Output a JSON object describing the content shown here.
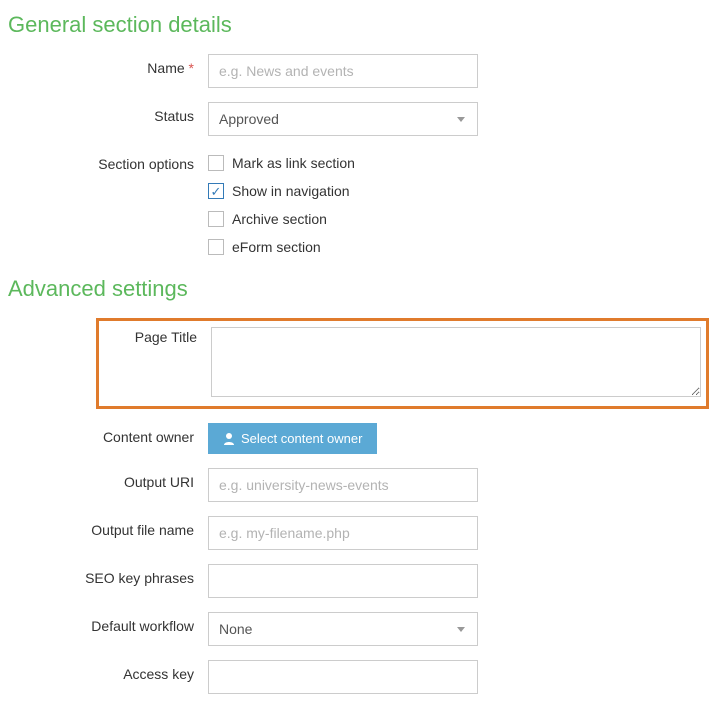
{
  "headings": {
    "general": "General section details",
    "advanced": "Advanced settings"
  },
  "general": {
    "name": {
      "label": "Name",
      "required_mark": "*",
      "placeholder": "e.g. News and events",
      "value": ""
    },
    "status": {
      "label": "Status",
      "selected": "Approved"
    },
    "options": {
      "label": "Section options",
      "items": [
        {
          "label": "Mark as link section",
          "checked": false
        },
        {
          "label": "Show in navigation",
          "checked": true
        },
        {
          "label": "Archive section",
          "checked": false
        },
        {
          "label": "eForm section",
          "checked": false
        }
      ]
    }
  },
  "advanced": {
    "page_title": {
      "label": "Page Title",
      "value": ""
    },
    "content_owner": {
      "label": "Content owner",
      "button": "Select content owner"
    },
    "output_uri": {
      "label": "Output URI",
      "placeholder": "e.g. university-news-events",
      "value": ""
    },
    "output_filename": {
      "label": "Output file name",
      "placeholder": "e.g. my-filename.php",
      "value": ""
    },
    "seo": {
      "label": "SEO key phrases",
      "value": ""
    },
    "default_workflow": {
      "label": "Default workflow",
      "selected": "None"
    },
    "access_key": {
      "label": "Access key",
      "value": ""
    }
  }
}
